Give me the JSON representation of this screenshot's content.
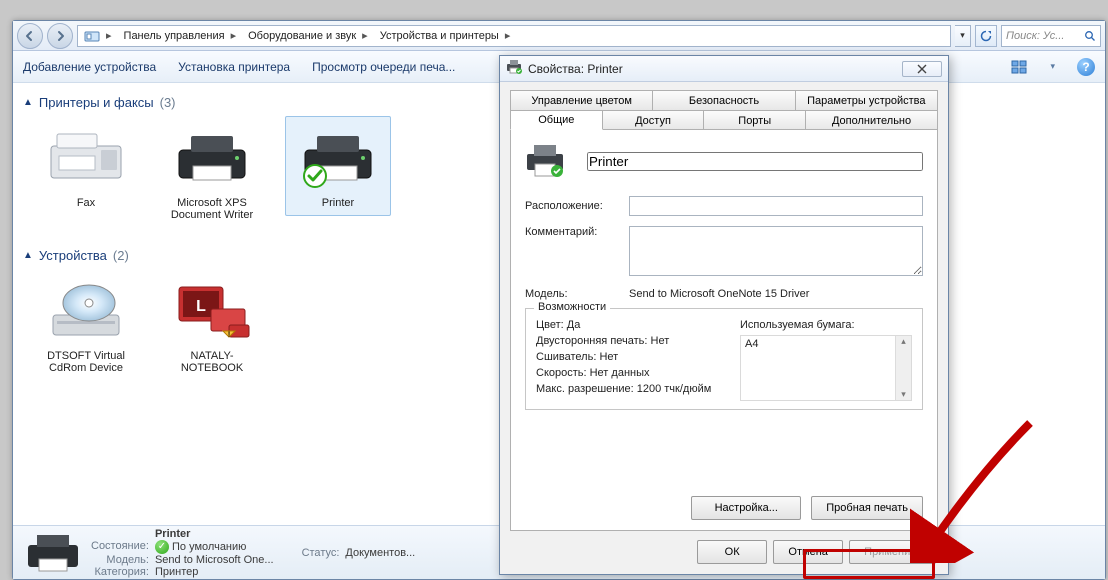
{
  "breadcrumbs": {
    "b0": "Панель управления",
    "b1": "Оборудование и звук",
    "b2": "Устройства и принтеры"
  },
  "search": {
    "placeholder": "Поиск: Ус..."
  },
  "cmdbar": {
    "add_device": "Добавление устройства",
    "install_printer": "Установка принтера",
    "view_queue": "Просмотр очереди печа..."
  },
  "groups": {
    "printers_label": "Принтеры и факсы",
    "printers_count": "(3)",
    "devices_label": "Устройства",
    "devices_count": "(2)"
  },
  "items": {
    "fax": "Fax",
    "xps": "Microsoft XPS Document Writer",
    "printer": "Printer",
    "dtsoft": "DTSOFT Virtual CdRom Device",
    "nataly": "NATALY-NOTEBOOK"
  },
  "status": {
    "name": "Printer",
    "state_label": "Состояние:",
    "state_value": "По умолчанию",
    "model_label": "Модель:",
    "model_value": "Send to Microsoft One...",
    "category_label": "Категория:",
    "category_value": "Принтер",
    "docs_label": "Статус:",
    "docs_value": "Документов..."
  },
  "dialog": {
    "title": "Свойства: Printer",
    "tabs": {
      "color": "Управление цветом",
      "security": "Безопасность",
      "device": "Параметры устройства",
      "general": "Общие",
      "sharing": "Доступ",
      "ports": "Порты",
      "advanced": "Дополнительно"
    },
    "name_value": "Printer",
    "location_label": "Расположение:",
    "comment_label": "Комментарий:",
    "model_label": "Модель:",
    "model_value": "Send to Microsoft OneNote 15 Driver",
    "caps_label": "Возможности",
    "caps": {
      "color": "Цвет: Да",
      "duplex": "Двусторонняя печать: Нет",
      "stapler": "Сшиватель: Нет",
      "speed": "Скорость: Нет данных",
      "maxres": "Макс. разрешение: 1200 тчк/дюйм"
    },
    "paper_label": "Используемая бумага:",
    "paper_value": "A4",
    "btn_settings": "Настройка...",
    "btn_testpage": "Пробная печать",
    "btn_ok": "ОК",
    "btn_cancel": "Отмена",
    "btn_apply": "Применить"
  }
}
